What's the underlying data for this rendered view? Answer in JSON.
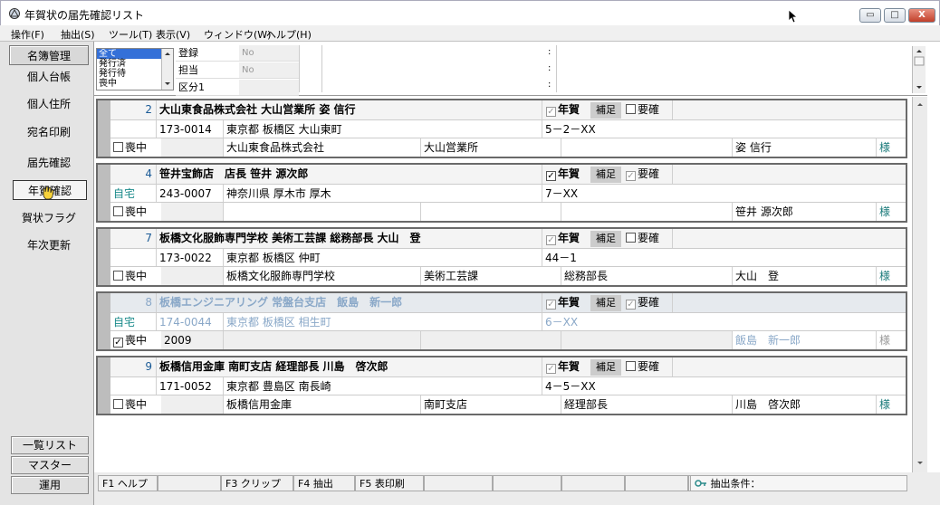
{
  "window": {
    "title": "年賀状の届先確認リスト",
    "min": "▭",
    "max": "□",
    "close": "X"
  },
  "menu": [
    "操作(F)",
    "抽出(S)",
    "ツール(T)",
    "表示(V)",
    "ウィンドウ(W)",
    "ヘルプ(H)"
  ],
  "sidebar": {
    "top": [
      "名簿管理",
      "個人台帳",
      "個人住所",
      "宛名印刷",
      "届先確認",
      "年賀確認",
      "賀状フラグ",
      "年次更新"
    ],
    "bottom": [
      "一覧リスト",
      "マスター",
      "運用"
    ]
  },
  "filter": {
    "list": [
      "全て",
      "発行済",
      "発行待",
      "喪中"
    ],
    "fields": [
      {
        "label": "登録",
        "value": "No"
      },
      {
        "label": "担当",
        "value": "No"
      },
      {
        "label": "区分1",
        "value": ""
      }
    ],
    "colon": ":"
  },
  "cards": [
    {
      "no": "2",
      "title": "大山東食品株式会社 大山営業所 姿 信行",
      "nenga": "年賀",
      "hosei": "補足",
      "youkaku": "要確",
      "type": "",
      "zip": "173-0014",
      "addr1": "東京都 板橋区 大山東町",
      "addr2": "5－2－XX",
      "mochu": "喪中",
      "mochu_year": "",
      "company": "大山東食品株式会社",
      "dept": "大山営業所",
      "post": "",
      "name": "姿 信行",
      "sama": "様"
    },
    {
      "no": "4",
      "title": "笹井宝飾店　店長 笹井 源次郎",
      "nenga": "年賀",
      "hosei": "補足",
      "youkaku": "要確",
      "type": "自宅",
      "zip": "243-0007",
      "addr1": "神奈川県 厚木市 厚木",
      "addr2": "7－XX",
      "mochu": "喪中",
      "mochu_year": "",
      "company": "",
      "dept": "",
      "post": "",
      "name": "笹井 源次郎",
      "sama": "様"
    },
    {
      "no": "7",
      "title": "板橋文化服飾専門学校 美術工芸課 総務部長 大山　登",
      "nenga": "年賀",
      "hosei": "補足",
      "youkaku": "要確",
      "type": "",
      "zip": "173-0022",
      "addr1": "東京都 板橋区 仲町",
      "addr2": "44－1",
      "mochu": "喪中",
      "mochu_year": "",
      "company": "板橋文化服飾専門学校",
      "dept": "美術工芸課",
      "post": "総務部長",
      "name": "大山　登",
      "sama": "様"
    },
    {
      "no": "8",
      "title": "板橋エンジニアリング 常盤台支店　飯島　新一郎",
      "nenga": "年賀",
      "hosei": "補足",
      "youkaku": "要確",
      "type": "自宅",
      "zip": "174-0044",
      "addr1": "東京都 板橋区 相生町",
      "addr2": "6－XX",
      "mochu": "喪中",
      "mochu_year": "2009",
      "company": "",
      "dept": "",
      "post": "",
      "name": "飯島　新一郎",
      "sama": "様"
    },
    {
      "no": "9",
      "title": "板橋信用金庫 南町支店 経理部長 川島　啓次郎",
      "nenga": "年賀",
      "hosei": "補足",
      "youkaku": "要確",
      "type": "",
      "zip": "171-0052",
      "addr1": "東京都 豊島区 南長崎",
      "addr2": "4－5－XX",
      "mochu": "喪中",
      "mochu_year": "",
      "company": "板橋信用金庫",
      "dept": "南町支店",
      "post": "経理部長",
      "name": "川島　啓次郎",
      "sama": "様"
    }
  ],
  "status": {
    "keys": [
      "F1 ヘルプ",
      "F3 クリップ",
      "F4 抽出",
      "F5 表印刷"
    ],
    "condition": "抽出条件："
  }
}
